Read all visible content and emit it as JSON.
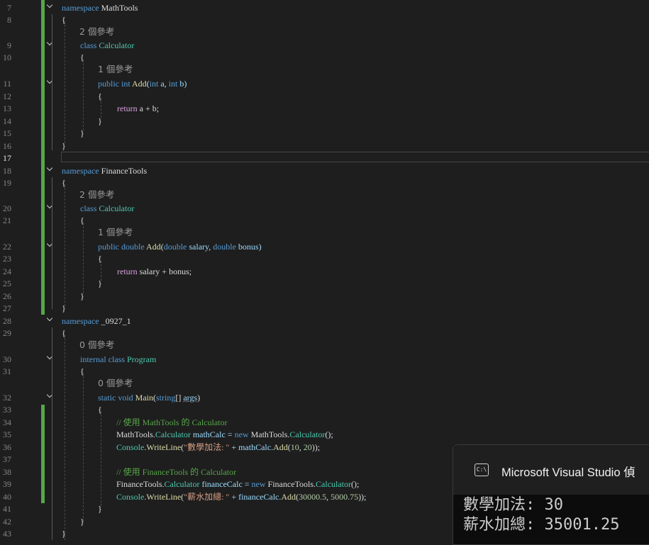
{
  "editor": {
    "line_numbers": [
      "7",
      "8",
      "9",
      "10",
      "11",
      "12",
      "13",
      "14",
      "15",
      "16",
      "17",
      "18",
      "19",
      "20",
      "21",
      "22",
      "23",
      "24",
      "25",
      "26",
      "27",
      "28",
      "29",
      "30",
      "31",
      "32",
      "33",
      "34",
      "35",
      "36",
      "37",
      "38",
      "39",
      "40",
      "41",
      "42",
      "43"
    ],
    "code": {
      "ns1_kw": "namespace",
      "ns1_name": "MathTools",
      "brace_open": "{",
      "brace_close": "}",
      "class_kw": "class",
      "calculator": "Calculator",
      "public_kw": "public",
      "int_kw": "int",
      "add": "Add",
      "paren_open": "(",
      "param_a": " a, ",
      "param_b": " b)",
      "return_kw": "return",
      "ret_ab": " a + b;",
      "ns2_name": "FinanceTools",
      "double_kw": "double",
      "p_salary": " salary, ",
      "p_bonus": " bonus)",
      "ret_fin": " salary + bonus;",
      "ns3_name": "_0927_1",
      "internal_kw": "internal",
      "program": "Program",
      "static_kw": "static",
      "void_kw": "void",
      "main": "Main",
      "string_kw": "string",
      "args_pre": "[] ",
      "args": "args",
      "close_paren": ")",
      "comment1": "// 使用 MathTools 的 Calculator",
      "mathtools": "MathTools",
      "dot": ".",
      "decl_math": " mathCalc = ",
      "new_kw": "new",
      "ctor_end": "();",
      "console": "Console",
      "writeline": "WriteLine",
      "str1": "\"數學加法: \"",
      "concat_math": " + mathCalc.",
      "args1_open": "(",
      "num10": "10",
      "comma": ", ",
      "num20": "20",
      "end_call": "));",
      "comment2": "// 使用 FinanceTools 的 Calculator",
      "financetools": "FinanceTools",
      "decl_fin": " financeCalc = ",
      "str2": "\"薪水加總: \"",
      "concat_fin": " + financeCalc.",
      "num30000": "30000.5",
      "num5000": "5000.75"
    },
    "refs": {
      "two_refs": "2 個參考",
      "one_ref": "1 個參考",
      "zero_refs": "0 個參考"
    }
  },
  "console": {
    "icon_text": "C:\\",
    "title": "Microsoft Visual Studio 偵",
    "output_lines": [
      "數學加法: 30",
      "薪水加總: 35001.25"
    ]
  },
  "colors": {
    "background": "#1e1e1e",
    "keyword": "#569cd6",
    "type": "#4ec9b0",
    "method": "#dcdcaa",
    "string": "#d69d85",
    "number": "#b5cea8",
    "comment": "#57a64a",
    "change_bar": "#57a64a"
  }
}
